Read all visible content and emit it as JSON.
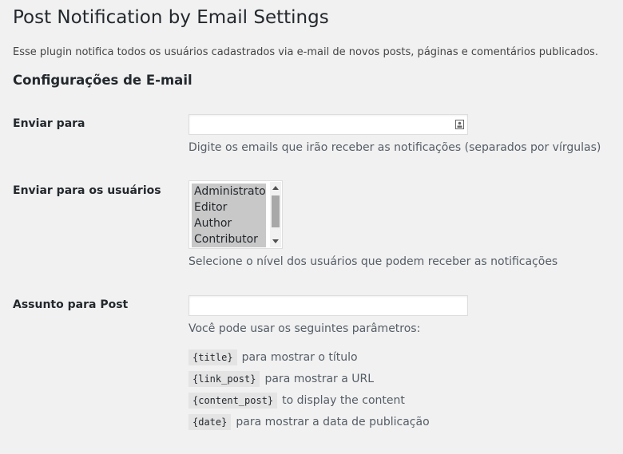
{
  "page": {
    "title": "Post Notification by Email Settings",
    "intro": "Esse plugin notifica todos os usuários cadastrados via e-mail de novos posts, páginas e comentários publicados.",
    "section_title": "Configurações de E-mail"
  },
  "send_to": {
    "label": "Enviar para",
    "value": "",
    "icon": "contact-card-icon",
    "description": "Digite os emails que irão receber as notificações (separados por vírgulas)"
  },
  "send_to_users": {
    "label": "Enviar para os usuários",
    "options": [
      "Administrator",
      "Editor",
      "Author",
      "Contributor"
    ],
    "selected": [
      "Administrator",
      "Editor",
      "Author",
      "Contributor"
    ],
    "description": "Selecione o nível dos usuários que podem receber as notificações"
  },
  "post_subject": {
    "label": "Assunto para Post",
    "value": "",
    "description": "Você pode usar os seguintes parâmetros:",
    "params": [
      {
        "code": "{title}",
        "text": "para mostrar o título"
      },
      {
        "code": "{link_post}",
        "text": "para mostrar a URL"
      },
      {
        "code": "{content_post}",
        "text": "to display the content"
      },
      {
        "code": "{date}",
        "text": "para mostrar a data de publicação"
      }
    ]
  },
  "colors": {
    "background": "#f1f1f1",
    "text": "#23282d",
    "description_text": "#555d66",
    "selected_option": "#c8c8c8",
    "code_background": "#e4e4e4"
  }
}
